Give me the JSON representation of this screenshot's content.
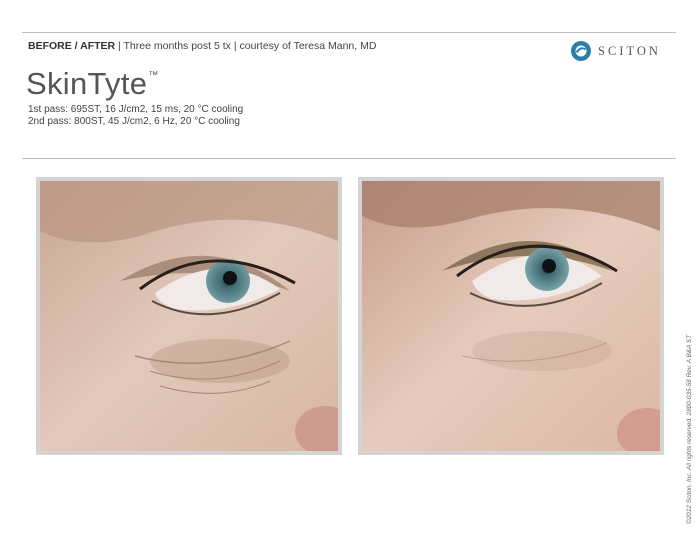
{
  "header": {
    "label": "BEFORE / AFTER",
    "details": "Three months post 5 tx",
    "credit": "courtesy of Teresa Mann, MD",
    "separator": "|"
  },
  "logo": {
    "name": "SCITON",
    "icon": "sciton-logo-icon",
    "color": "#2a7fa8"
  },
  "product": {
    "name": "SkinTyte",
    "trademark": "™"
  },
  "settings": {
    "line1": "1st pass: 695ST, 16 J/cm2, 15 ms, 20 °C cooling",
    "line2": "2nd pass: 800ST, 45 J/cm2, 6 Hz, 20 °C cooling"
  },
  "photos": [
    {
      "name": "before-photo",
      "icon": "eye-closeup-before"
    },
    {
      "name": "after-photo",
      "icon": "eye-closeup-after"
    }
  ],
  "copyright": "©2012 Sciton, Inc. All rights reserved. 2800-035-58 Rev. A B&A ST"
}
